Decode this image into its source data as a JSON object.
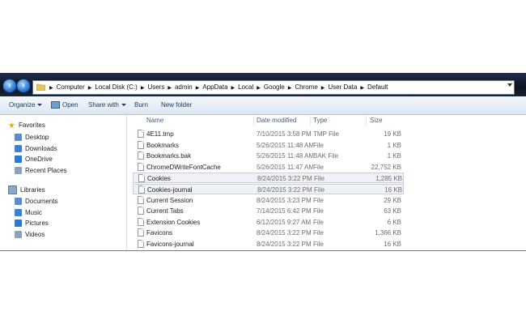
{
  "address": {
    "crumbs": [
      "Computer",
      "Local Disk (C:)",
      "Users",
      "admin",
      "AppData",
      "Local",
      "Google",
      "Chrome",
      "User Data",
      "Default"
    ],
    "separator": "▶"
  },
  "toolbar": {
    "organize_label": "Organize",
    "open_label": "Open",
    "share_label": "Share with",
    "burn_label": "Burn",
    "new_folder_label": "New folder"
  },
  "sidebar": {
    "favorites_label": "Favorites",
    "favorites": [
      {
        "label": "Desktop",
        "icon": "desktop-icon"
      },
      {
        "label": "Downloads",
        "icon": "downloads-icon"
      },
      {
        "label": "OneDrive",
        "icon": "onedrive-icon"
      },
      {
        "label": "Recent Places",
        "icon": "recent-places-icon"
      }
    ],
    "libraries_label": "Libraries",
    "libraries": [
      {
        "label": "Documents",
        "icon": "documents-icon"
      },
      {
        "label": "Music",
        "icon": "music-icon"
      },
      {
        "label": "Pictures",
        "icon": "pictures-icon"
      },
      {
        "label": "Videos",
        "icon": "videos-icon"
      }
    ]
  },
  "columns": {
    "name": "Name",
    "date": "Date modified",
    "type": "Type",
    "size": "Size"
  },
  "files": [
    {
      "name": "4E11.tmp",
      "date": "7/10/2015 3:58 PM",
      "type": "TMP File",
      "size": "19 KB",
      "selected": false
    },
    {
      "name": "Bookmarks",
      "date": "5/26/2015 11:48 AM",
      "type": "File",
      "size": "1 KB",
      "selected": false
    },
    {
      "name": "Bookmarks.bak",
      "date": "5/26/2015 11:48 AM",
      "type": "BAK File",
      "size": "1 KB",
      "selected": false
    },
    {
      "name": "ChromeDWriteFontCache",
      "date": "5/26/2015 11:47 AM",
      "type": "File",
      "size": "22,752 KB",
      "selected": false
    },
    {
      "name": "Cookies",
      "date": "8/24/2015 3:22 PM",
      "type": "File",
      "size": "1,285 KB",
      "selected": true
    },
    {
      "name": "Cookies-journal",
      "date": "8/24/2015 3:22 PM",
      "type": "File",
      "size": "16 KB",
      "selected": true
    },
    {
      "name": "Current Session",
      "date": "8/24/2015 3:23 PM",
      "type": "File",
      "size": "29 KB",
      "selected": false
    },
    {
      "name": "Current Tabs",
      "date": "7/14/2015 6:42 PM",
      "type": "File",
      "size": "63 KB",
      "selected": false
    },
    {
      "name": "Extension Cookies",
      "date": "6/12/2015 9:27 AM",
      "type": "File",
      "size": "6 KB",
      "selected": false
    },
    {
      "name": "Favicons",
      "date": "8/24/2015 3:22 PM",
      "type": "File",
      "size": "1,366 KB",
      "selected": false
    },
    {
      "name": "Favicons-journal",
      "date": "8/24/2015 3:22 PM",
      "type": "File",
      "size": "16 KB",
      "selected": false
    }
  ],
  "colors": {
    "accent": "#1e395b",
    "selection": "#eef1f5"
  }
}
